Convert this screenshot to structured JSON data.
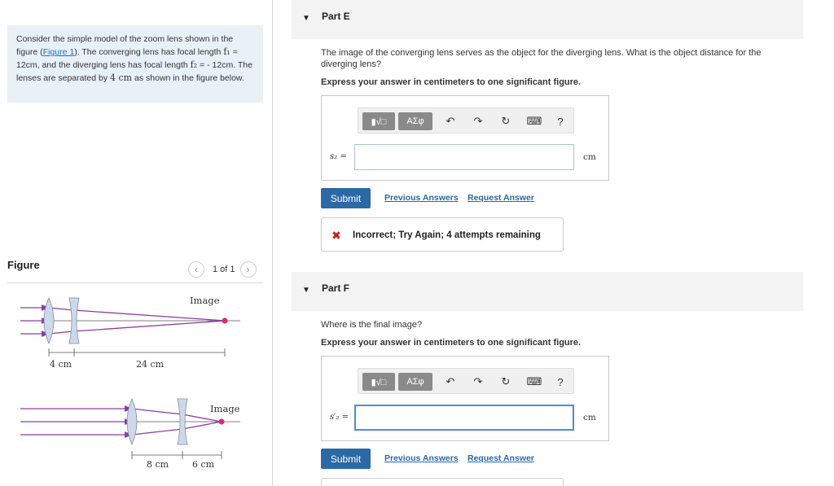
{
  "problem": {
    "intro": {
      "p1": "Consider the simple model of the zoom lens shown in the figure (",
      "link": "Figure 1",
      "p2": "). The converging lens has focal length ",
      "f1_sym": "f₁",
      "f1_val": " = 12cm",
      "p3": ", and the diverging lens has focal length ",
      "f2_sym": "f₂",
      "f2_val": " = - 12cm",
      "p4": ". The lenses are separated by ",
      "sep_val": "4 cm",
      "p5": " as shown in the figure below."
    }
  },
  "figure": {
    "title": "Figure",
    "pager": {
      "prev_icon": "chevron-left-icon",
      "count": "1 of 1",
      "next_icon": "chevron-right-icon"
    },
    "top_image_label": "Image",
    "top_dim_1": "4 cm",
    "top_dim_2": "24 cm",
    "bottom_image_label": "Image",
    "bottom_dim_1": "8 cm",
    "bottom_dim_2": "6 cm",
    "colors": {
      "ray": "#8a3da6",
      "image_dot": "#e0266f",
      "axis": "#555555",
      "lens": "#cdd9e8"
    }
  },
  "toolbar": {
    "template_icon": "template-icon",
    "greek_label": "ΑΣφ",
    "undo_icon": "undo-icon",
    "redo_icon": "redo-icon",
    "reset_icon": "reset-icon",
    "keyboard_icon": "keyboard-icon",
    "help_label": "?"
  },
  "partE": {
    "title": "Part E",
    "question": "The image of the converging lens serves as the object for the diverging lens. What is the object distance for the diverging lens?",
    "instruction": "Express your answer in centimeters to one significant figure.",
    "variable": "s₂ =",
    "input_value": "",
    "unit": "cm",
    "submit": "Submit",
    "prev_answers": "Previous Answers",
    "request_answer": "Request Answer",
    "feedback": "Incorrect; Try Again; 4 attempts remaining",
    "feedback_icon": "x-icon"
  },
  "partF": {
    "title": "Part F",
    "question": "Where is the final image?",
    "instruction": "Express your answer in centimeters to one significant figure.",
    "variable": "s′₂ =",
    "input_value": "",
    "unit": "cm",
    "submit": "Submit",
    "prev_answers": "Previous Answers",
    "request_answer": "Request Answer"
  },
  "accent": {
    "submit_bg": "#2b69a6",
    "link": "#2968a8",
    "error": "#d0191f",
    "panel_bg": "#e8f1f8"
  }
}
